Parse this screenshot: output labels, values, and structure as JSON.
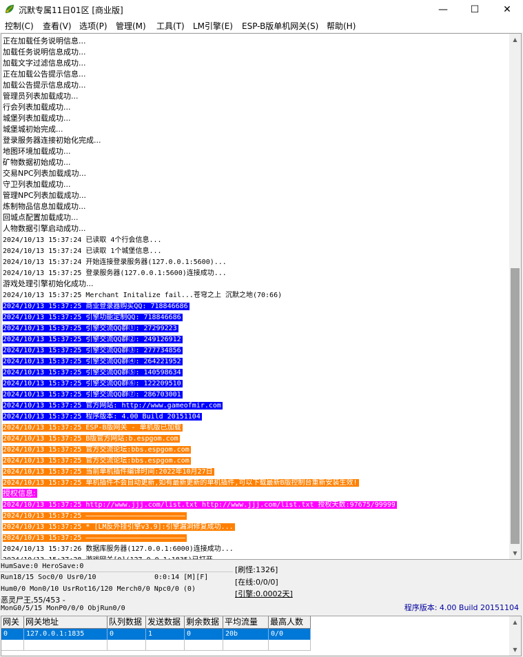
{
  "window": {
    "title": "沉默专属11日01区 [商业版]",
    "icon": "app-leaf-icon",
    "controls": {
      "minimize": "—",
      "maximize": "☐",
      "close": "✕"
    }
  },
  "menu": [
    "控制(C)",
    "查看(V)",
    "选项(P)",
    "管理(M)",
    "工具(T)",
    "LM引擎(E)",
    "ESP-B版单机网关(S)",
    "帮助(H)"
  ],
  "colors": {
    "blue_highlight": "#0000ff",
    "orange_highlight": "#ff8000",
    "magenta_highlight": "#ff00ff",
    "selection": "#0078d7",
    "version_text": "#0000a0"
  },
  "log": [
    {
      "text": "正在加载任务说明信息...",
      "style": "plain"
    },
    {
      "text": "加载任务说明信息成功...",
      "style": "plain"
    },
    {
      "text": "加载文字过滤信息成功...",
      "style": "plain"
    },
    {
      "text": "正在加载公告提示信息...",
      "style": "plain"
    },
    {
      "text": "加载公告提示信息成功...",
      "style": "plain"
    },
    {
      "text": "管理员列表加载成功...",
      "style": "plain"
    },
    {
      "text": "行会列表加载成功...",
      "style": "plain"
    },
    {
      "text": "城堡列表加载成功...",
      "style": "plain"
    },
    {
      "text": "城堡城初始完成...",
      "style": "plain"
    },
    {
      "text": "登录服务器连接初始化完成...",
      "style": "plain"
    },
    {
      "text": "地图环境加载成功...",
      "style": "plain"
    },
    {
      "text": "矿物数据初始成功...",
      "style": "plain"
    },
    {
      "text": "交易NPC列表加载成功...",
      "style": "plain"
    },
    {
      "text": "守卫列表加载成功...",
      "style": "plain"
    },
    {
      "text": "管理NPC列表加载成功...",
      "style": "plain"
    },
    {
      "text": "炼制物品信息加载成功...",
      "style": "plain"
    },
    {
      "text": "回城点配置加载成功...",
      "style": "plain"
    },
    {
      "text": "人物数据引擎启动成功...",
      "style": "plain"
    },
    {
      "text": "2024/10/13 15:37:24 已读取 4个行会信息...",
      "style": "plain"
    },
    {
      "text": "2024/10/13 15:37:24 已读取 1个城堡信息...",
      "style": "plain"
    },
    {
      "text": "2024/10/13 15:37:24 开始连接登录服务器(127.0.0.1:5600)...",
      "style": "plain"
    },
    {
      "text": "2024/10/13 15:37:25 登录服务器(127.0.0.1:5600)连接成功...",
      "style": "plain"
    },
    {
      "text": "游戏处理引擎初始化成功...",
      "style": "plain"
    },
    {
      "text": "2024/10/13 15:37:25 Merchant Initalize fail...苍穹之上 沉默之地(70:66)",
      "style": "plain"
    },
    {
      "text": "2024/10/13 15:37:25 商业登录器购买QQ: 718846686",
      "style": "blue"
    },
    {
      "text": "2024/10/13 15:37:25 引擎功能定制QQ: 718846686",
      "style": "blue"
    },
    {
      "text": "2024/10/13 15:37:25 引擎交流QQ群①: 27299223",
      "style": "blue"
    },
    {
      "text": "2024/10/13 15:37:25 引擎交流QQ群②: 249126912",
      "style": "blue"
    },
    {
      "text": "2024/10/13 15:37:25 引擎交流QQ群③: 277734856",
      "style": "blue"
    },
    {
      "text": "2024/10/13 15:37:25 引擎交流QQ群④: 264221952",
      "style": "blue"
    },
    {
      "text": "2024/10/13 15:37:25 引擎交流QQ群⑤: 140598634",
      "style": "blue"
    },
    {
      "text": "2024/10/13 15:37:25 引擎交流QQ群⑥: 122209510",
      "style": "blue"
    },
    {
      "text": "2024/10/13 15:37:25 引擎交流QQ群⑦: 286703001",
      "style": "blue"
    },
    {
      "text": "2024/10/13 15:37:25 官方网站: http://www.gameofmir.com",
      "style": "blue"
    },
    {
      "text": "2024/10/13 15:37:25 程序版本: 4.00 Build 20151104",
      "style": "blue"
    },
    {
      "text": "2024/10/13 15:37:25 ESP-B版网关 - 单机版已加载",
      "style": "orange"
    },
    {
      "text": "2024/10/13 15:37:25 B版官方网站:b.espgom.com",
      "style": "orange"
    },
    {
      "text": "2024/10/13 15:37:25 官方交流论坛:bbs.espgom.com",
      "style": "orange"
    },
    {
      "text": "2024/10/13 15:37:25 官方交流论坛:bbs.espgom.com",
      "style": "orange"
    },
    {
      "text": "2024/10/13 15:37:25 当前单机插件编译时间:2022年10月27日",
      "style": "orange"
    },
    {
      "text": "2024/10/13 15:37:25 单机插件不会自动更新,如有最新更新的单机插件,可以下载最新B版控制台重新安装生效!",
      "style": "orange"
    },
    {
      "text": "授权信息:",
      "style": "magenta"
    },
    {
      "text": "2024/10/13 15:37:25 http://www.jjj.com/list.txt http://www.jjj.com/list.txt 授权天数:97675/99999",
      "style": "magenta"
    },
    {
      "text": "2024/10/13 15:37:25 ————————————————————————",
      "style": "orange"
    },
    {
      "text": "2024/10/13 15:37:25 * [LM反外挂引擎v3.9]:引擎漏洞修复成功...",
      "style": "orange"
    },
    {
      "text": "2024/10/13 15:37:25 ————————————————————————",
      "style": "orange"
    },
    {
      "text": "2024/10/13 15:37:26 数据库服务器(127.0.0.1:6000)连接成功...",
      "style": "plain"
    },
    {
      "text": "2024/10/13 15:37:28 游戏网关[0](127.0.0.1:1835)已打开...",
      "style": "plain"
    }
  ],
  "status": {
    "hum_save": "HumSave:0 HeroSave:0",
    "run": "Run18/15 Soc0/0 Usr0/10",
    "uptime": "0:0:14 [M][F]",
    "hum": "Hum0/0 Mon0/10 UsrRot16/120 Merch0/0 Npc0/0 (0)",
    "boss": "恶灵尸王,55/453 -",
    "mon": "MonG0/5/15 MonP0/0/0 ObjRun0/0",
    "refresh": "[刷怪:1326]",
    "online": "[在线:0/0/0]",
    "engine": "[引擎:0.0002天]",
    "version": "程序版本: 4.00 Build 20151104"
  },
  "gateway_table": {
    "columns": [
      "网关",
      "网关地址",
      "队列数据",
      "发送数据",
      "剩余数据",
      "平均流量",
      "最高人数"
    ],
    "rows": [
      [
        "0",
        "127.0.0.1:1835",
        "0",
        "1",
        "0",
        "20b",
        "0/0"
      ]
    ]
  }
}
